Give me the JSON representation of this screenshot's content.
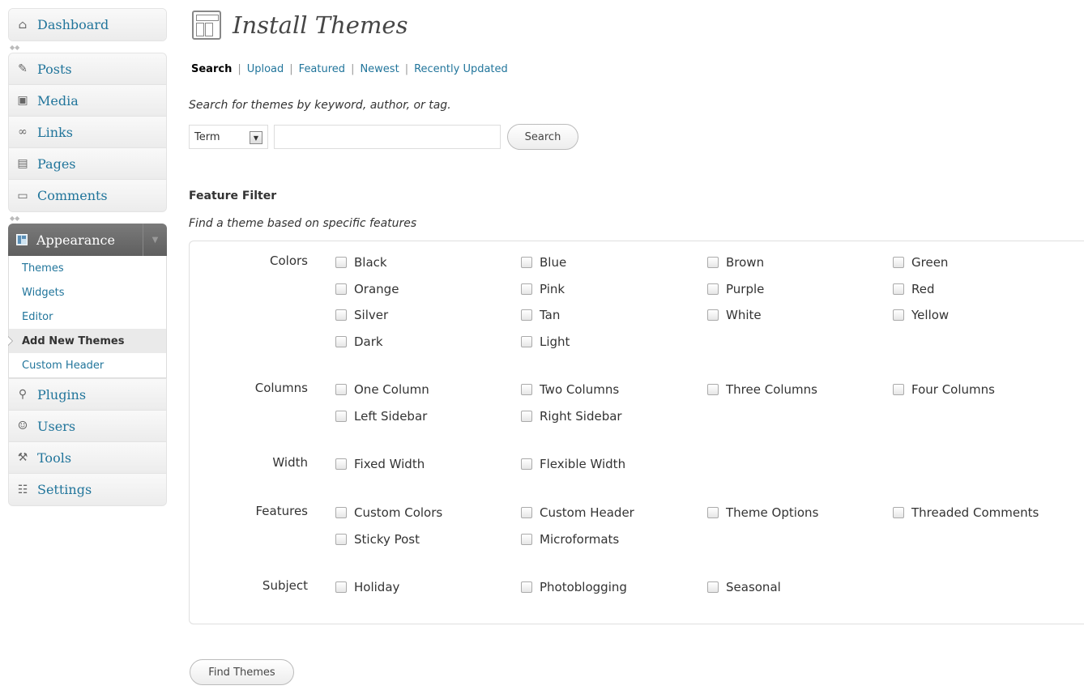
{
  "sidebar": {
    "top_group": [
      {
        "name": "dashboard",
        "icon": "house-icon",
        "label": "Dashboard"
      }
    ],
    "content_group": [
      {
        "name": "posts",
        "icon": "pushpin-icon",
        "label": "Posts"
      },
      {
        "name": "media",
        "icon": "camera-icon",
        "label": "Media"
      },
      {
        "name": "links",
        "icon": "chain-link-icon",
        "label": "Links"
      },
      {
        "name": "pages",
        "icon": "pages-icon",
        "label": "Pages"
      },
      {
        "name": "comments",
        "icon": "speech-bubble-icon",
        "label": "Comments"
      }
    ],
    "appearance": {
      "icon": "appearance-icon",
      "label": "Appearance",
      "submenu": [
        {
          "name": "themes",
          "label": "Themes",
          "current": false
        },
        {
          "name": "widgets",
          "label": "Widgets",
          "current": false
        },
        {
          "name": "editor",
          "label": "Editor",
          "current": false
        },
        {
          "name": "add-new-themes",
          "label": "Add New Themes",
          "current": true
        },
        {
          "name": "custom-header",
          "label": "Custom Header",
          "current": false
        }
      ]
    },
    "admin_group": [
      {
        "name": "plugins",
        "icon": "plug-icon",
        "label": "Plugins"
      },
      {
        "name": "users",
        "icon": "users-icon",
        "label": "Users"
      },
      {
        "name": "tools",
        "icon": "wrench-icon",
        "label": "Tools"
      },
      {
        "name": "settings",
        "icon": "settings-icon",
        "label": "Settings"
      }
    ]
  },
  "main": {
    "title": "Install Themes",
    "subnav": [
      {
        "name": "search",
        "label": "Search",
        "current": true
      },
      {
        "name": "upload",
        "label": "Upload",
        "current": false
      },
      {
        "name": "featured",
        "label": "Featured",
        "current": false
      },
      {
        "name": "newest",
        "label": "Newest",
        "current": false
      },
      {
        "name": "recently-updated",
        "label": "Recently Updated",
        "current": false
      }
    ],
    "search": {
      "description": "Search for themes by keyword, author, or tag.",
      "type_value": "Term",
      "input_value": "",
      "button_label": "Search"
    },
    "feature_filter": {
      "title": "Feature Filter",
      "description": "Find a theme based on specific features",
      "groups": [
        {
          "name": "colors",
          "label": "Colors",
          "options": [
            "Black",
            "Blue",
            "Brown",
            "Green",
            "Orange",
            "Pink",
            "Purple",
            "Red",
            "Silver",
            "Tan",
            "White",
            "Yellow",
            "Dark",
            "Light"
          ]
        },
        {
          "name": "columns",
          "label": "Columns",
          "options": [
            "One Column",
            "Two Columns",
            "Three Columns",
            "Four Columns",
            "Left Sidebar",
            "Right Sidebar"
          ]
        },
        {
          "name": "width",
          "label": "Width",
          "options": [
            "Fixed Width",
            "Flexible Width"
          ]
        },
        {
          "name": "features",
          "label": "Features",
          "options": [
            "Custom Colors",
            "Custom Header",
            "Theme Options",
            "Threaded Comments",
            "Sticky Post",
            "Microformats"
          ]
        },
        {
          "name": "subject",
          "label": "Subject",
          "options": [
            "Holiday",
            "Photoblogging",
            "Seasonal"
          ]
        }
      ]
    },
    "find_button_label": "Find Themes"
  }
}
